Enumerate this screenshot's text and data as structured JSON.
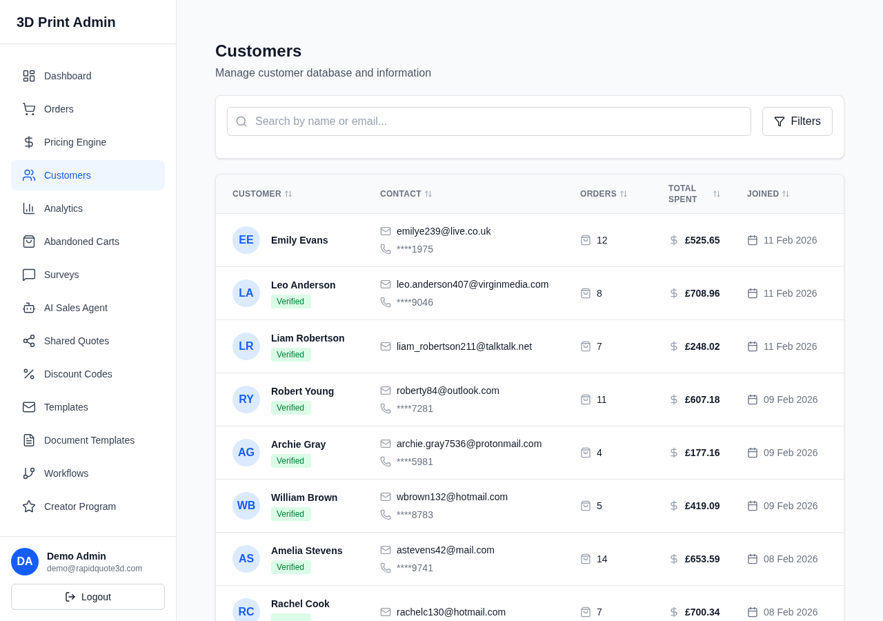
{
  "brand": "3D Print Admin",
  "nav": [
    {
      "label": "Dashboard",
      "selected": false
    },
    {
      "label": "Orders",
      "selected": false
    },
    {
      "label": "Pricing Engine",
      "selected": false
    },
    {
      "label": "Customers",
      "selected": true
    },
    {
      "label": "Analytics",
      "selected": false
    },
    {
      "label": "Abandoned Carts",
      "selected": false
    },
    {
      "label": "Surveys",
      "selected": false
    },
    {
      "label": "AI Sales Agent",
      "selected": false
    },
    {
      "label": "Shared Quotes",
      "selected": false
    },
    {
      "label": "Discount Codes",
      "selected": false
    },
    {
      "label": "Templates",
      "selected": false
    },
    {
      "label": "Document Templates",
      "selected": false
    },
    {
      "label": "Workflows",
      "selected": false
    },
    {
      "label": "Creator Program",
      "selected": false
    }
  ],
  "user": {
    "initials": "DA",
    "name": "Demo Admin",
    "email": "demo@rapidquote3d.com"
  },
  "logout": "Logout",
  "page": {
    "title": "Customers",
    "subtitle": "Manage customer database and information"
  },
  "search": {
    "placeholder": "Search by name or email..."
  },
  "filters": "Filters",
  "table": {
    "columns": [
      "CUSTOMER",
      "CONTACT",
      "ORDERS",
      "TOTAL SPENT",
      "JOINED"
    ],
    "rows": [
      {
        "initials": "EE",
        "name": "Emily Evans",
        "verified": false,
        "email": "emilye239@live.co.uk",
        "phone": "****1975",
        "orders": "12",
        "spent": "£525.65",
        "joined": "11 Feb 2026"
      },
      {
        "initials": "LA",
        "name": "Leo Anderson",
        "verified": true,
        "badge": "Verified",
        "email": "leo.anderson407@virginmedia.com",
        "phone": "****9046",
        "orders": "8",
        "spent": "£708.96",
        "joined": "11 Feb 2026"
      },
      {
        "initials": "LR",
        "name": "Liam Robertson",
        "verified": true,
        "badge": "Verified",
        "email": "liam_robertson211@talktalk.net",
        "orders": "7",
        "spent": "£248.02",
        "joined": "11 Feb 2026"
      },
      {
        "initials": "RY",
        "name": "Robert Young",
        "verified": true,
        "badge": "Verified",
        "email": "roberty84@outlook.com",
        "phone": "****7281",
        "orders": "11",
        "spent": "£607.18",
        "joined": "09 Feb 2026"
      },
      {
        "initials": "AG",
        "name": "Archie Gray",
        "verified": true,
        "badge": "Verified",
        "email": "archie.gray7536@protonmail.com",
        "phone": "****5981",
        "orders": "4",
        "spent": "£177.16",
        "joined": "09 Feb 2026"
      },
      {
        "initials": "WB",
        "name": "William Brown",
        "verified": true,
        "badge": "Verified",
        "email": "wbrown132@hotmail.com",
        "phone": "****8783",
        "orders": "5",
        "spent": "£419.09",
        "joined": "09 Feb 2026"
      },
      {
        "initials": "AS",
        "name": "Amelia Stevens",
        "verified": true,
        "badge": "Verified",
        "email": "astevens42@mail.com",
        "phone": "****9741",
        "orders": "14",
        "spent": "£653.59",
        "joined": "08 Feb 2026"
      },
      {
        "initials": "RC",
        "name": "Rachel Cook",
        "verified": true,
        "email": "rachelc130@hotmail.com",
        "orders": "7",
        "spent": "£700.34",
        "joined": "08 Feb 2026"
      }
    ]
  }
}
